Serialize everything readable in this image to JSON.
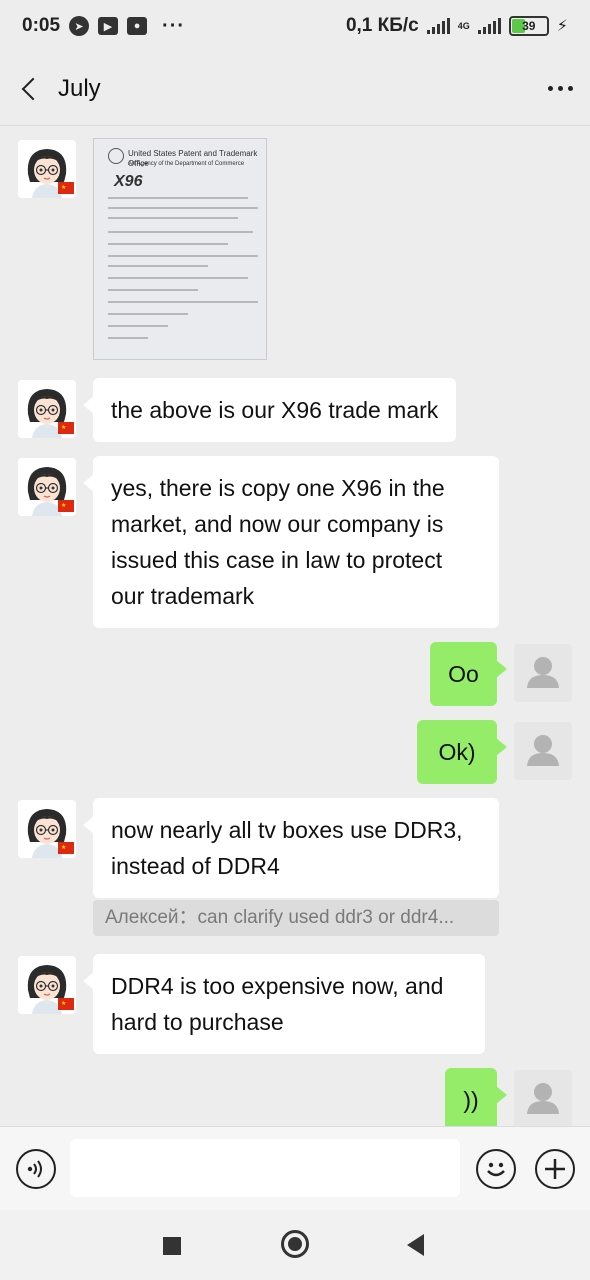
{
  "status_bar": {
    "time": "0:05",
    "net_speed": "0,1 КБ/с",
    "network_type": "4G",
    "battery_level": "39",
    "icons": [
      "telegram-icon",
      "youtube-icon",
      "app-icon",
      "more-notifications-icon",
      "signal-icon",
      "battery-icon",
      "charging-icon"
    ]
  },
  "header": {
    "title": "July",
    "back_icon": "chevron-left-icon",
    "more_icon": "more-dots-icon"
  },
  "messages": [
    {
      "side": "in",
      "type": "image",
      "image_title": "United States Patent and Trademark Office",
      "image_subtitle": "An Agency of the Department of Commerce",
      "image_logo": "X96"
    },
    {
      "side": "in",
      "type": "text",
      "text": "the above is our X96 trade mark"
    },
    {
      "side": "in",
      "type": "text",
      "text": "yes, there is copy one X96 in the market, and now our company is issued this case in law to protect our trademark"
    },
    {
      "side": "out",
      "type": "text",
      "text": "Oo"
    },
    {
      "side": "out",
      "type": "text",
      "text": "Ok)"
    },
    {
      "side": "in",
      "type": "text",
      "text": "now nearly all tv boxes use DDR3, instead of DDR4"
    },
    {
      "side": "quote",
      "text": "Алексей：can clarify used ddr3 or ddr4..."
    },
    {
      "side": "in",
      "type": "text",
      "text": "DDR4 is too expensive now, and hard to purchase"
    },
    {
      "side": "out",
      "type": "text",
      "text": "))"
    }
  ],
  "input_bar": {
    "voice_icon": "voice-icon",
    "emoji_icon": "emoji-icon",
    "plus_icon": "plus-icon",
    "placeholder": ""
  },
  "colors": {
    "background": "#ededed",
    "outgoing_bubble": "#95ec69",
    "incoming_bubble": "#ffffff",
    "quote_bg": "#dcdcdc",
    "battery_fill": "#5cc94a",
    "flag_red": "#de2910"
  }
}
